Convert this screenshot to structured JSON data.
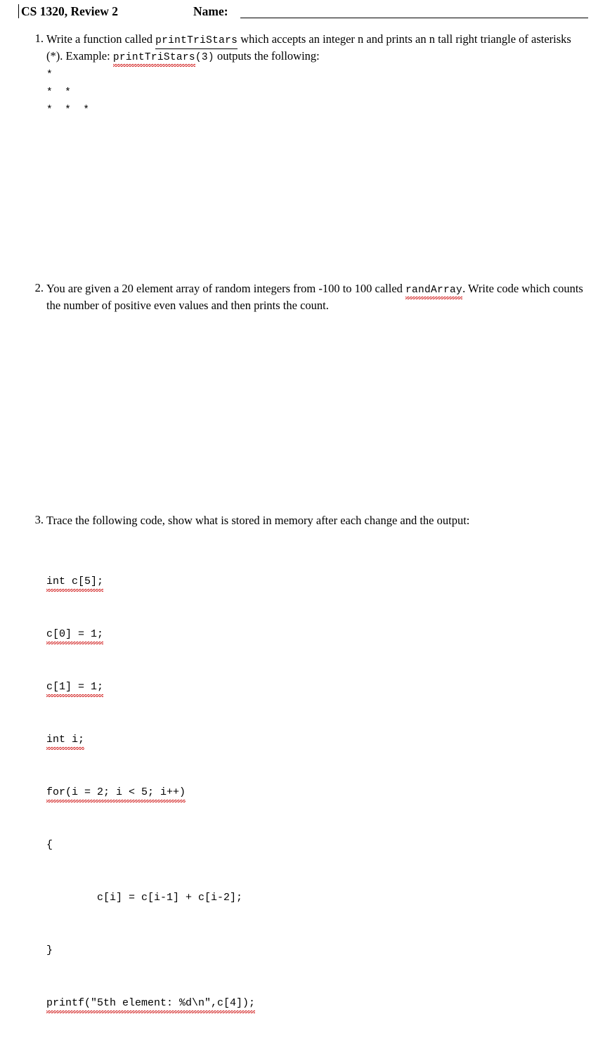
{
  "header": {
    "course_title": "CS 1320, Review 2",
    "name_label": "Name:"
  },
  "questions": [
    {
      "number": "1.",
      "text_before_code": "Write a function called ",
      "code_1": "printTriStars",
      "text_mid": " which accepts an integer n and prints an n tall right triangle of asterisks (*). Example: ",
      "code_2": "printTriStars",
      "code_2b": "(3)",
      "text_after": " outputs the following:",
      "output_lines": [
        "*",
        "*  *",
        "*  *  *"
      ]
    },
    {
      "number": "2.",
      "text_1": "You are given a 20 element array of random integers from -100 to 100 called ",
      "code_1": "randArray",
      "text_2": ". Write code which counts the number of positive even values and then prints the count."
    },
    {
      "number": "3.",
      "text_1": "Trace the following code, show what is stored in memory after each change and the output:",
      "code_lines": [
        "int c[5];",
        "c[0] = 1;",
        "c[1] = 1;",
        "int i;",
        "for(i = 2; i < 5; i++)",
        "{",
        "        c[i] = c[i-1] + c[i-2];",
        "}",
        "printf(\"5th element: %d\\n\",c[4]);"
      ]
    }
  ],
  "colors": {
    "spelling_underline": "#d21f1f",
    "grammar_underline": "#18a018",
    "text": "#000000",
    "background": "#ffffff"
  }
}
